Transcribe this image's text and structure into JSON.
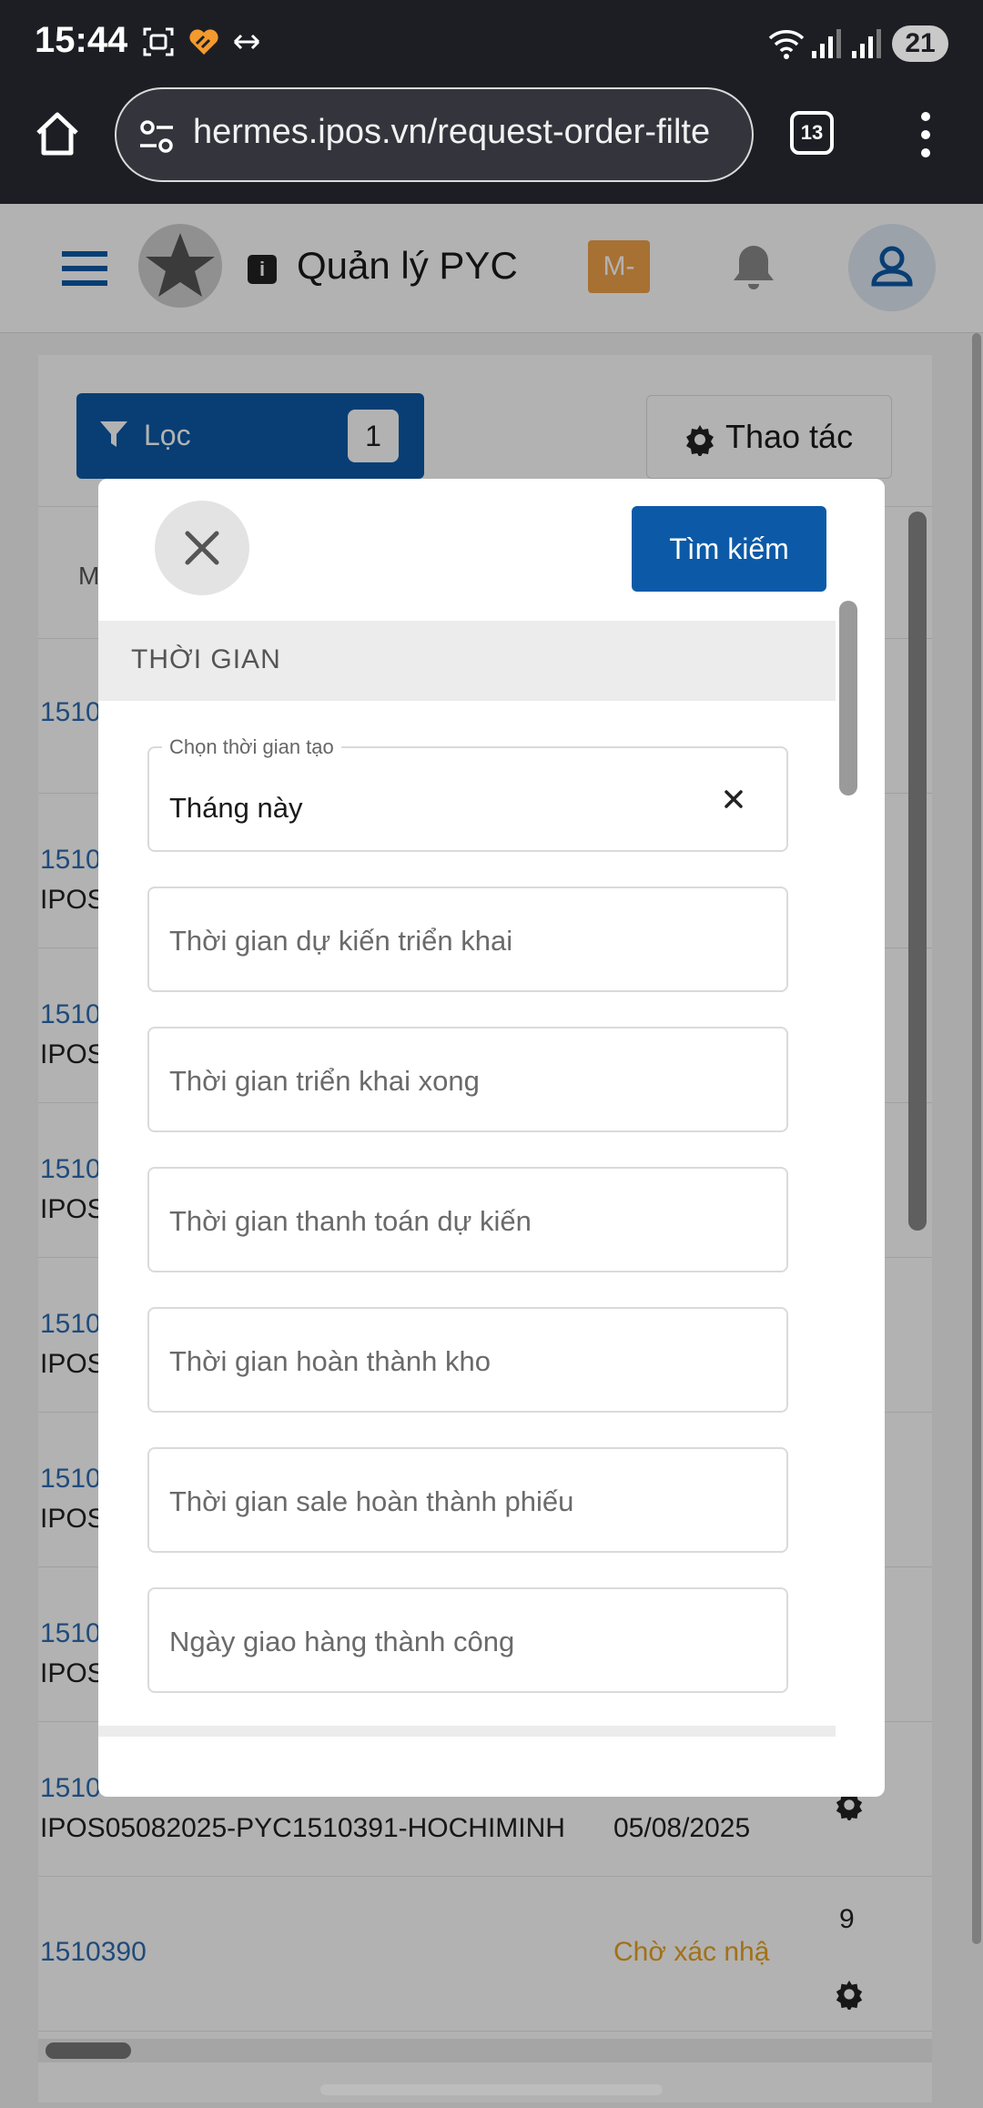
{
  "status_bar": {
    "time": "15:44",
    "battery": "21",
    "icons": [
      "screenshot-icon",
      "heart-app-icon",
      "data-saver-icon",
      "wifi-icon",
      "signal-icon",
      "signal-icon-2"
    ]
  },
  "browser": {
    "url": "hermes.ipos.vn/request-order-filte",
    "tab_count": "13"
  },
  "app_header": {
    "title": "Quản lý PYC",
    "info_glyph": "i",
    "badge": "M-"
  },
  "toolbar": {
    "filter_label": "Lọc",
    "filter_count": "1",
    "action_label": "Thao tác"
  },
  "table": {
    "header_first": "M",
    "rows": [
      {
        "id": "1510",
        "code": "",
        "date": "",
        "status": "",
        "num": ""
      },
      {
        "id": "1510",
        "code": "IPOS",
        "date": "",
        "status": "",
        "num": ""
      },
      {
        "id": "1510",
        "code": "IPOS",
        "date": "",
        "status": "",
        "num": ""
      },
      {
        "id": "1510",
        "code": "IPOS",
        "date": "",
        "status": "",
        "num": ""
      },
      {
        "id": "1510",
        "code": "IPOS",
        "date": "",
        "status": "",
        "num": ""
      },
      {
        "id": "1510",
        "code": "IPOS",
        "date": "",
        "status": "",
        "num": ""
      },
      {
        "id": "1510",
        "code": "IPOS",
        "date": "",
        "status": "",
        "num": ""
      },
      {
        "id": "1510",
        "code": "IPOS05082025-PYC1510391-HOCHIMINH",
        "date": "05/08/2025",
        "status": "",
        "num": ""
      },
      {
        "id": "1510390",
        "code": "",
        "date": "",
        "status": "Chờ xác nhậ",
        "num": "9"
      }
    ]
  },
  "modal": {
    "search_label": "Tìm kiếm",
    "section_title": "THỜI GIAN",
    "created_field": {
      "label": "Chọn thời gian tạo",
      "value": "Tháng này"
    },
    "placeholders": [
      "Thời gian dự kiến triển khai",
      "Thời gian triển khai xong",
      "Thời gian thanh toán dự kiến",
      "Thời gian hoàn thành kho",
      "Thời gian sale hoàn thành phiếu",
      "Ngày giao hàng thành công"
    ]
  },
  "colors": {
    "primary": "#0c5aa7",
    "link": "#2e6cb0",
    "pending": "#e8a322",
    "badge": "#f0a24a"
  }
}
